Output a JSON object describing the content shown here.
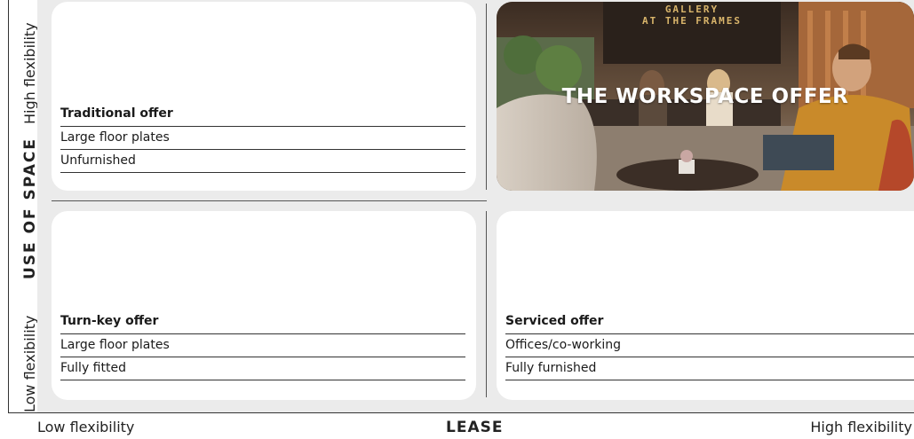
{
  "vertical_axis": {
    "title": "USE OF SPACE",
    "low_label": "Low flexibility",
    "high_label": "High flexibility"
  },
  "horizontal_axis": {
    "title": "LEASE",
    "low_label": "Low flexibility",
    "high_label": "High flexibility"
  },
  "quadrants": {
    "top_left": {
      "title": "Traditional offer",
      "lines": [
        "Large floor plates",
        "Unfurnished"
      ]
    },
    "bottom_left": {
      "title": "Turn-key offer",
      "lines": [
        "Large floor plates",
        "Fully fitted"
      ]
    },
    "bottom_right": {
      "title": "Serviced offer",
      "lines": [
        "Offices/co-working",
        "Fully furnished"
      ]
    },
    "top_right": {
      "photo_title": "THE WORKSPACE OFFER",
      "sign_text_line1": "GALLERY",
      "sign_text_line2": "AT THE FRAMES"
    }
  },
  "colors": {
    "panel_background": "#ebebeb",
    "card_background": "#ffffff",
    "photo_tone_warm": "#c46a2a"
  }
}
